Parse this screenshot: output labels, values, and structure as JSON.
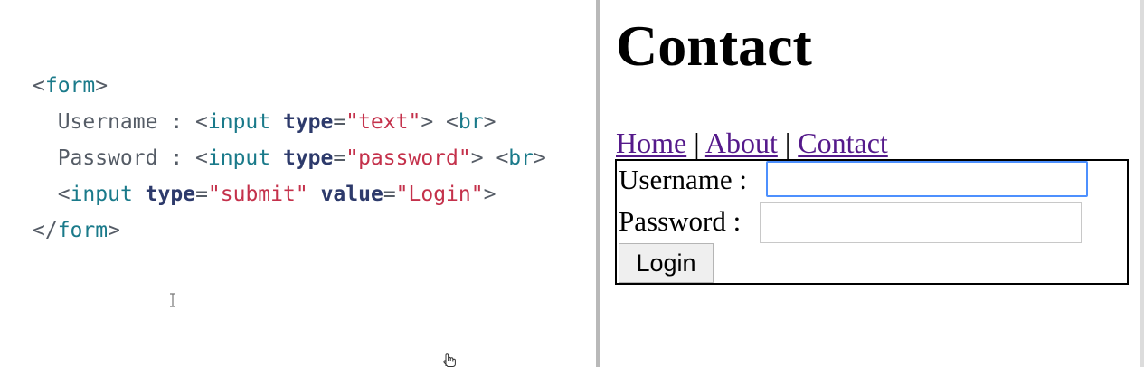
{
  "editor": {
    "lines": [
      [
        "<",
        "form",
        ">"
      ],
      [
        "  Username : ",
        "<",
        "input",
        " ",
        "type",
        "=",
        "\"text\"",
        ">",
        " ",
        "<",
        "br",
        ">"
      ],
      [
        "  Password : ",
        "<",
        "input",
        " ",
        "type",
        "=",
        "\"password\"",
        ">",
        " ",
        "<",
        "br",
        ">"
      ],
      [
        "  ",
        "<",
        "input",
        " ",
        "type",
        "=",
        "\"submit\"",
        " ",
        "value",
        "=",
        "\"Login\"",
        ">"
      ],
      [
        "</",
        "form",
        ">"
      ]
    ]
  },
  "preview": {
    "title": "Contact",
    "nav": {
      "home": "Home",
      "about": "About",
      "contact": "Contact",
      "separator": "|"
    },
    "form": {
      "username_label": "Username :",
      "username_value": "",
      "password_label": "Password :",
      "password_value": "",
      "submit_label": "Login"
    }
  },
  "colors": {
    "tag": "#1a7a8a",
    "attribute": "#2d3a6b",
    "string": "#c4314b",
    "punctuation": "#555c66",
    "link_visited": "#551a8b",
    "focus_ring": "#4d90fe"
  }
}
